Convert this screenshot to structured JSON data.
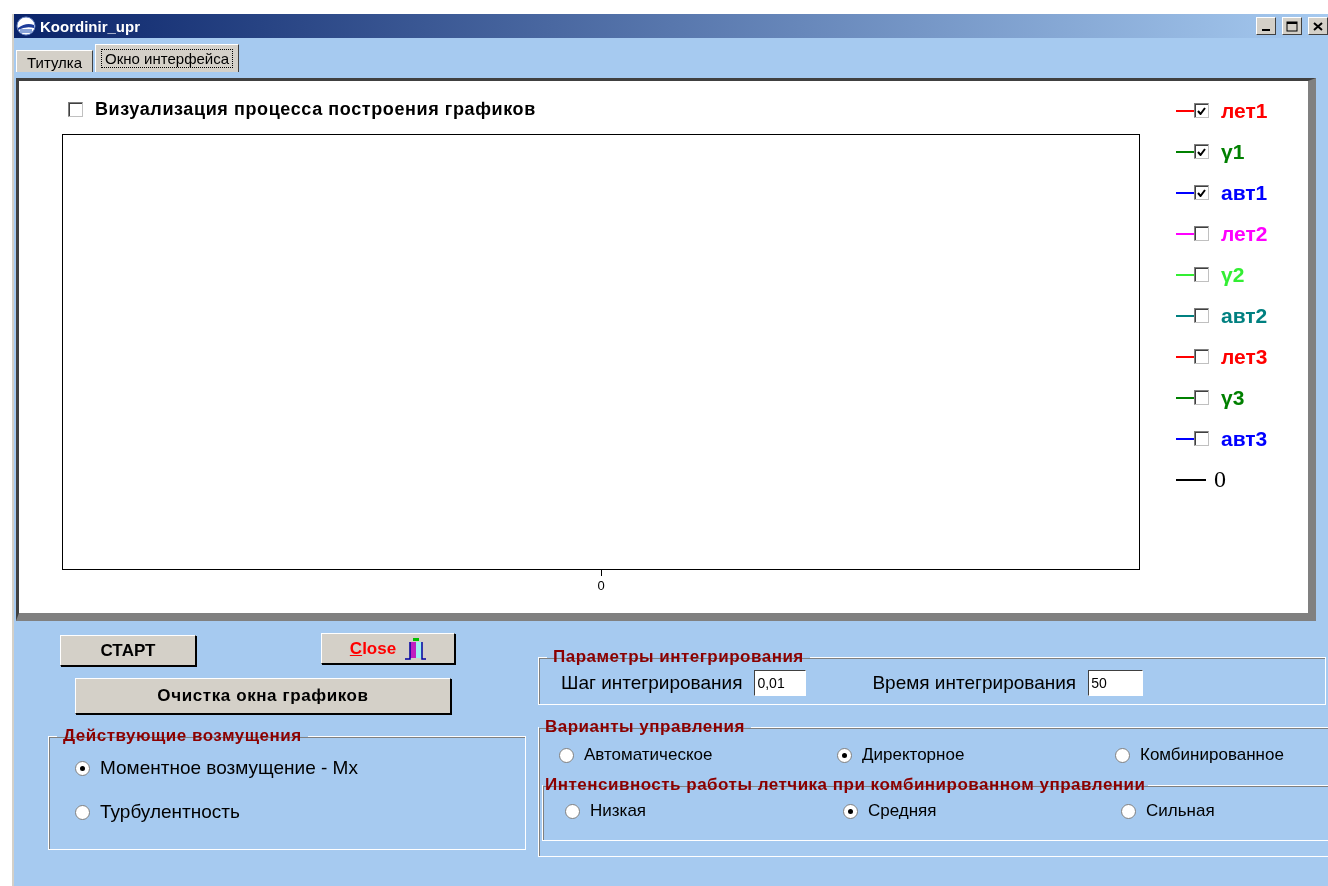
{
  "window": {
    "title": "Koordinir_upr"
  },
  "tabs": [
    {
      "label": "Титулка",
      "selected": false
    },
    {
      "label": "Окно интерфейса",
      "selected": true
    }
  ],
  "visualize": {
    "label": "Визуализация процесса построения графиков",
    "checked": false
  },
  "plot": {
    "x_tick": "0"
  },
  "legend": [
    {
      "kind": "checkbox",
      "label": "лет1",
      "color": "#ff0000",
      "checked": true
    },
    {
      "kind": "checkbox",
      "label": "γ1",
      "color": "#008000",
      "checked": true
    },
    {
      "kind": "checkbox",
      "label": "авт1",
      "color": "#0000ff",
      "checked": true
    },
    {
      "kind": "checkbox",
      "label": "лет2",
      "color": "#ff00ff",
      "checked": false
    },
    {
      "kind": "checkbox",
      "label": "γ2",
      "color": "#33ee33",
      "checked": false
    },
    {
      "kind": "checkbox",
      "label": "авт2",
      "color": "#008080",
      "checked": false
    },
    {
      "kind": "checkbox",
      "label": "лет3",
      "color": "#ff0000",
      "checked": false
    },
    {
      "kind": "checkbox",
      "label": "γ3",
      "color": "#008000",
      "checked": false
    },
    {
      "kind": "checkbox",
      "label": "авт3",
      "color": "#0000ff",
      "checked": false
    },
    {
      "kind": "line",
      "label": "0",
      "color": "#000000"
    }
  ],
  "buttons": {
    "start": "СТАРТ",
    "close": "Close",
    "clear": "Очистка окна графиков"
  },
  "disturbances": {
    "title": "Действующие возмущения",
    "options": [
      {
        "label": "Моментное возмущение - Mx",
        "selected": true
      },
      {
        "label": "Турбулентность",
        "selected": false
      }
    ]
  },
  "integration": {
    "title": "Параметры интегрирования",
    "fields": [
      {
        "label": "Шаг интегрирования",
        "value": "0,01"
      },
      {
        "label": "Время интегрирования",
        "value": "50"
      }
    ]
  },
  "control_variants": {
    "title": "Варианты управления",
    "options": [
      {
        "label": "Автоматическое",
        "selected": false
      },
      {
        "label": "Директорное",
        "selected": true
      },
      {
        "label": "Комбинированное",
        "selected": false
      }
    ],
    "intensity": {
      "title": "Интенсивность работы летчика при комбинированном управлении",
      "options": [
        {
          "label": "Низкая",
          "selected": false
        },
        {
          "label": "Средняя",
          "selected": true
        },
        {
          "label": "Сильная",
          "selected": false
        }
      ]
    }
  }
}
